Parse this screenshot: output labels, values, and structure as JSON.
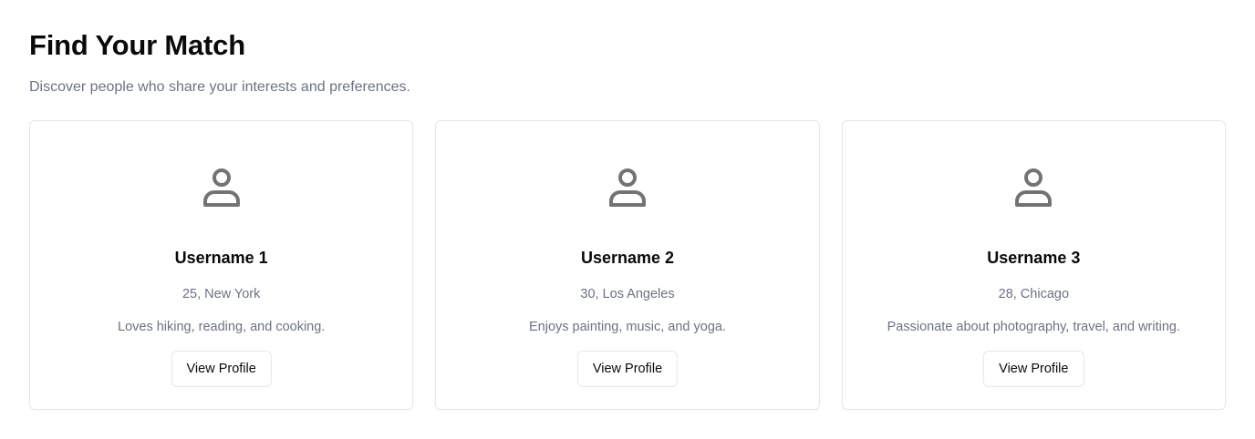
{
  "header": {
    "title": "Find Your Match",
    "subtitle": "Discover people who share your interests and preferences."
  },
  "profiles": [
    {
      "name": "Username 1",
      "meta": "25, New York",
      "bio": "Loves hiking, reading, and cooking.",
      "button_label": "View Profile",
      "icon": "user-icon"
    },
    {
      "name": "Username 2",
      "meta": "30, Los Angeles",
      "bio": "Enjoys painting, music, and yoga.",
      "button_label": "View Profile",
      "icon": "user-icon"
    },
    {
      "name": "Username 3",
      "meta": "28, Chicago",
      "bio": "Passionate about photography, travel, and writing.",
      "button_label": "View Profile",
      "icon": "user-icon"
    }
  ],
  "colors": {
    "text_primary": "#0a0a0a",
    "text_muted": "#6b7280",
    "border": "#e5e7eb",
    "icon": "#737373"
  }
}
